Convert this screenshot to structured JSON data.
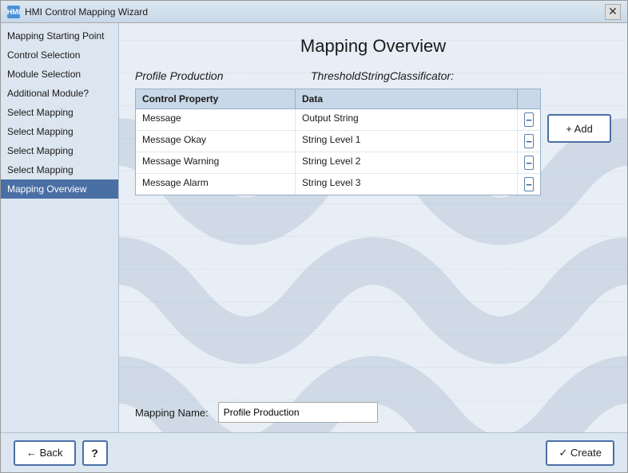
{
  "window": {
    "title": "HMI Control Mapping Wizard",
    "icon_label": "HMI"
  },
  "sidebar": {
    "items": [
      {
        "label": "Mapping Starting Point",
        "active": false
      },
      {
        "label": "Control Selection",
        "active": false
      },
      {
        "label": "Module Selection",
        "active": false
      },
      {
        "label": "Additional Module?",
        "active": false
      },
      {
        "label": "Select Mapping",
        "active": false
      },
      {
        "label": "Select Mapping",
        "active": false
      },
      {
        "label": "Select Mapping",
        "active": false
      },
      {
        "label": "Select Mapping",
        "active": false
      },
      {
        "label": "Mapping Overview",
        "active": true
      }
    ]
  },
  "main": {
    "page_title": "Mapping Overview",
    "profile_label": "Profile Production",
    "threshold_label": "ThresholdStringClassificator:",
    "table": {
      "headers": [
        "Control Property",
        "Data",
        ""
      ],
      "rows": [
        {
          "property": "Message",
          "data": "Output String"
        },
        {
          "property": "Message Okay",
          "data": "String Level 1"
        },
        {
          "property": "Message Warning",
          "data": "String Level 2"
        },
        {
          "property": "Message Alarm",
          "data": "String Level 3"
        }
      ]
    },
    "add_button": "+ Add",
    "mapping_name_label": "Mapping Name:",
    "mapping_name_value": "Profile Production"
  },
  "footer": {
    "back_label": "← Back",
    "help_label": "?",
    "create_label": "✓ Create"
  }
}
